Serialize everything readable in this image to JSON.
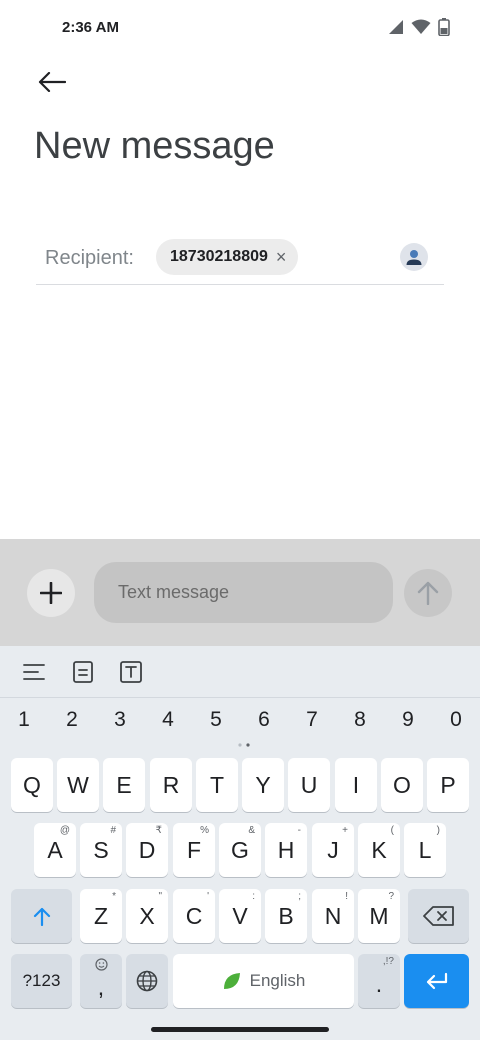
{
  "status_bar": {
    "time": "2:36 AM"
  },
  "header": {
    "title": "New message"
  },
  "recipient": {
    "label": "Recipient:",
    "chip_number": "18730218809",
    "chip_remove": "×"
  },
  "compose": {
    "placeholder": "Text message"
  },
  "keyboard": {
    "numbers": [
      "1",
      "2",
      "3",
      "4",
      "5",
      "6",
      "7",
      "8",
      "9",
      "0"
    ],
    "row1": [
      "Q",
      "W",
      "E",
      "R",
      "T",
      "Y",
      "U",
      "I",
      "O",
      "P"
    ],
    "row2": [
      "A",
      "S",
      "D",
      "F",
      "G",
      "H",
      "J",
      "K",
      "L"
    ],
    "row2_hints": [
      "@",
      "#",
      "₹",
      "%",
      "&",
      "-",
      "+",
      "(",
      ")"
    ],
    "row3": [
      "Z",
      "X",
      "C",
      "V",
      "B",
      "N",
      "M"
    ],
    "row3_hints": [
      "*",
      "\"",
      "'",
      ":",
      ";",
      "!",
      "?"
    ],
    "symbols_label": "?123",
    "comma_label": ",",
    "space_label": "English",
    "period_label": ".",
    "period_hint": ",!?",
    "enter_color": "#1a8ef0",
    "shift_color": "#1a8ef0"
  },
  "icons": {
    "back": "arrow-left-icon",
    "contact": "person-icon",
    "attach": "plus-icon",
    "send": "arrow-up-icon",
    "shift": "shift-arrow-icon",
    "backspace": "backspace-icon",
    "emoji": "emoji-icon",
    "language": "globe-icon",
    "enter": "enter-icon"
  }
}
